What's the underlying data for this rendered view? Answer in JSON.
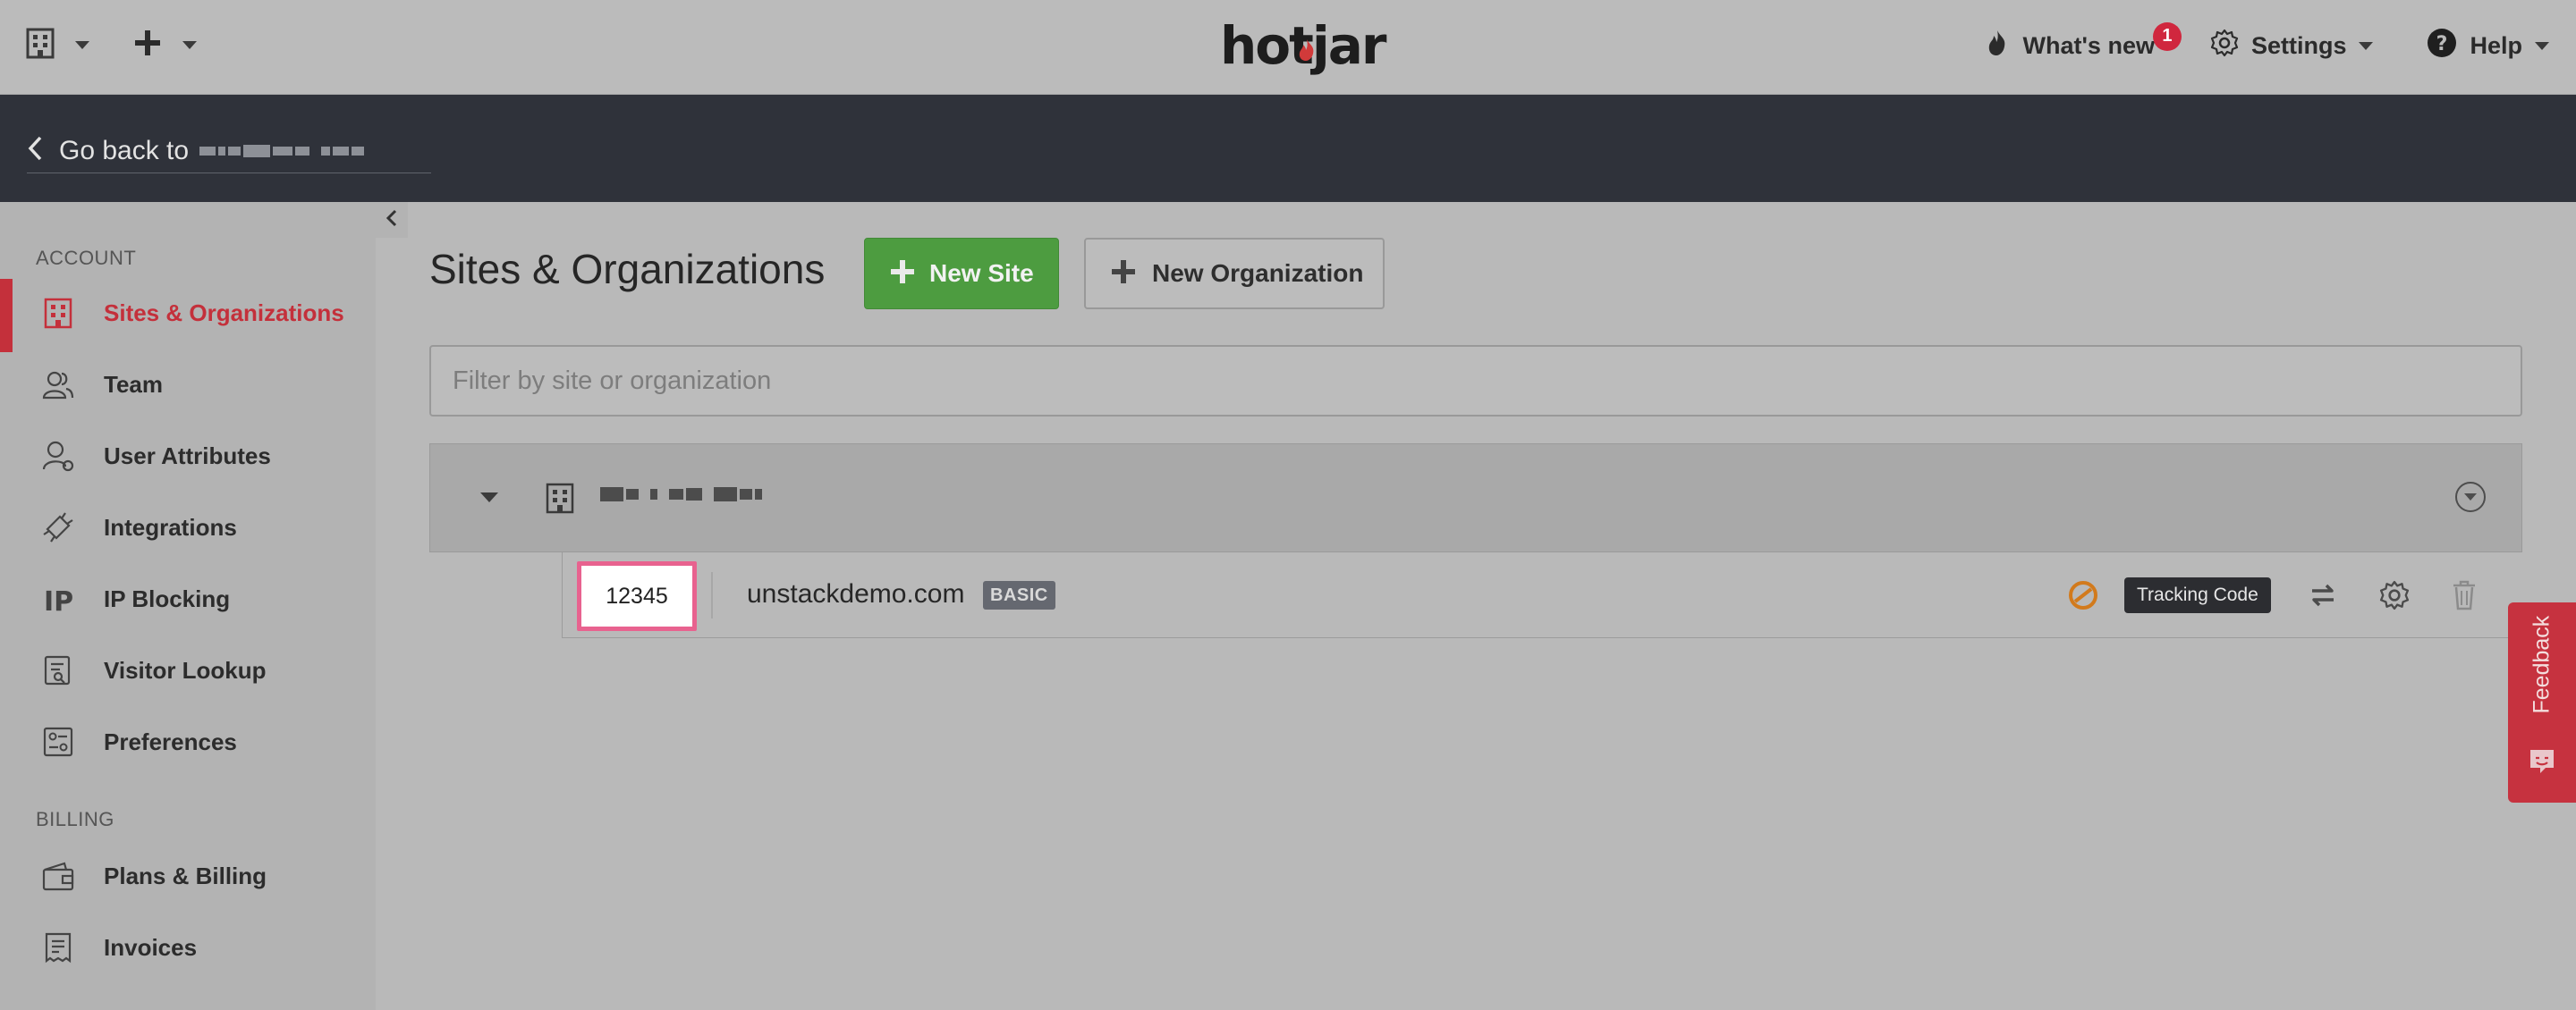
{
  "topbar": {
    "logo": "hotjar",
    "whats_new": "What's new",
    "whats_new_count": "1",
    "settings": "Settings",
    "help": "Help"
  },
  "darkbar": {
    "go_back": "Go back to"
  },
  "sidebar": {
    "account_title": "ACCOUNT",
    "billing_title": "BILLING",
    "items": [
      {
        "label": "Sites & Organizations",
        "icon": "building-icon",
        "active": true
      },
      {
        "label": "Team",
        "icon": "team-icon"
      },
      {
        "label": "User Attributes",
        "icon": "user-attributes-icon"
      },
      {
        "label": "Integrations",
        "icon": "integrations-icon"
      },
      {
        "label": "IP Blocking",
        "icon": "ip-icon"
      },
      {
        "label": "Visitor Lookup",
        "icon": "visitor-lookup-icon"
      },
      {
        "label": "Preferences",
        "icon": "preferences-icon"
      }
    ],
    "billing_items": [
      {
        "label": "Plans & Billing",
        "icon": "wallet-icon"
      },
      {
        "label": "Invoices",
        "icon": "invoice-icon"
      }
    ]
  },
  "main": {
    "title": "Sites & Organizations",
    "new_site": "New Site",
    "new_org": "New Organization",
    "filter_placeholder": "Filter by site or organization",
    "site": {
      "id": "12345",
      "domain": "unstackdemo.com",
      "plan": "BASIC",
      "tracking_label": "Tracking Code"
    }
  },
  "feedback": {
    "label": "Feedback"
  },
  "colors": {
    "accent_red": "#c4303b",
    "green": "#4d9c40",
    "highlight_pink": "#e8628f",
    "dark_bar": "#2f323a"
  }
}
